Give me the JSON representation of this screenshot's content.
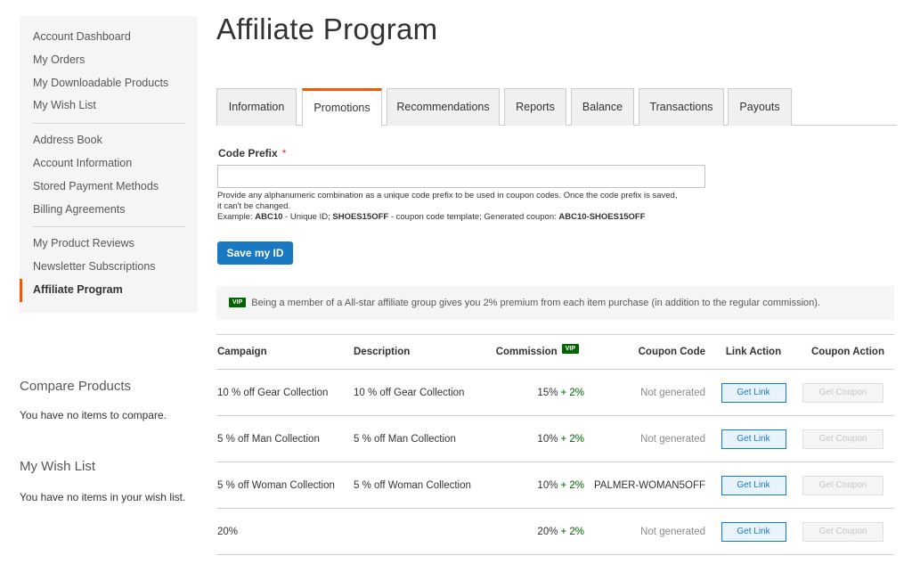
{
  "sidebar": {
    "group1": [
      "Account Dashboard",
      "My Orders",
      "My Downloadable Products",
      "My Wish List"
    ],
    "group2": [
      "Address Book",
      "Account Information",
      "Stored Payment Methods",
      "Billing Agreements"
    ],
    "group3": [
      "My Product Reviews",
      "Newsletter Subscriptions",
      "Affiliate Program"
    ],
    "active": "Affiliate Program",
    "accent_color": "#ff5501"
  },
  "compare": {
    "title": "Compare Products",
    "empty": "You have no items to compare."
  },
  "wishlist": {
    "title": "My Wish List",
    "empty": "You have no items in your wish list."
  },
  "page": {
    "title": "Affiliate Program"
  },
  "tabs": [
    "Information",
    "Promotions",
    "Recommendations",
    "Reports",
    "Balance",
    "Transactions",
    "Payouts"
  ],
  "active_tab": "Promotions",
  "form": {
    "label": "Code Prefix",
    "required_mark": "*",
    "value": "",
    "note_line1": "Provide any alphanumeric combination as a unique code prefix to be used in coupon codes. Once the code prefix is saved,",
    "note_line2": "it can't be changed.",
    "example_label": "Example: ",
    "example_id": "ABC10",
    "example_id_suffix": " - Unique ID; ",
    "example_template": "SHOES15OFF",
    "example_template_suffix": " - coupon code template; Generated coupon: ",
    "example_coupon": "ABC10-SHOES15OFF",
    "save_label": "Save my ID"
  },
  "vip_banner": {
    "badge": "VIP",
    "text": "Being a member of a All-star affiliate group gives you 2% premium from each item purchase (in addition to the regular commission)."
  },
  "table": {
    "headers": {
      "campaign": "Campaign",
      "description": "Description",
      "commission": "Commission",
      "commission_badge": "VIP",
      "coupon_code": "Coupon Code",
      "link_action": "Link Action",
      "coupon_action": "Coupon Action"
    },
    "rows": [
      {
        "campaign": "10 % off Gear Collection",
        "description": "10 % off Gear Collection",
        "commission": "15%",
        "bonus": "+ 2%",
        "coupon_code": "Not generated",
        "link_btn": "Get Link",
        "coupon_btn": "Get Coupon"
      },
      {
        "campaign": "5 % off Man Collection",
        "description": "5 % off Man Collection",
        "commission": "10%",
        "bonus": "+ 2%",
        "coupon_code": "Not generated",
        "link_btn": "Get Link",
        "coupon_btn": "Get Coupon"
      },
      {
        "campaign": "5 % off Woman Collection",
        "description": "5 % off Woman Collection",
        "commission": "10%",
        "bonus": "+ 2%",
        "coupon_code": "PALMER-WOMAN5OFF",
        "link_btn": "Get Link",
        "coupon_btn": "Get Coupon"
      },
      {
        "campaign": "20%",
        "description": "",
        "commission": "20%",
        "bonus": "+ 2%",
        "coupon_code": "Not generated",
        "link_btn": "Get Link",
        "coupon_btn": "Get Coupon"
      }
    ]
  },
  "colors": {
    "primary": "#1979c3",
    "vip": "#006400",
    "accent": "#ff5501",
    "required": "#e02b27"
  }
}
